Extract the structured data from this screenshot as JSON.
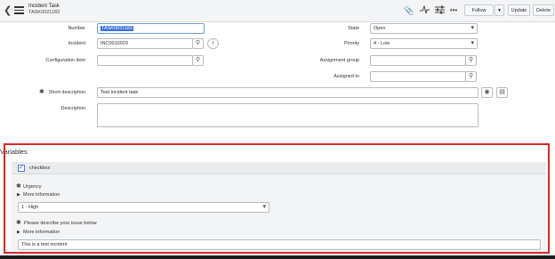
{
  "header": {
    "title": "Incident Task",
    "subtitle": "TASK0021183",
    "buttons": {
      "follow": "Follow",
      "update": "Update",
      "delete": "Delete"
    },
    "icons": [
      "paperclip-icon",
      "activity-icon",
      "settings-sliders-icon",
      "more-icon"
    ]
  },
  "form": {
    "number": {
      "label": "Number",
      "value": "TASK0021183"
    },
    "incident": {
      "label": "Incident",
      "value": "INC0010029"
    },
    "configuration_item": {
      "label": "Configuration item",
      "value": ""
    },
    "state": {
      "label": "State",
      "value": "Open"
    },
    "priority": {
      "label": "Priority",
      "value": "4 - Low"
    },
    "assignment_group": {
      "label": "Assignment group",
      "value": ""
    },
    "assigned_to": {
      "label": "Assigned to",
      "value": ""
    },
    "short_description": {
      "label": "Short description",
      "value": "Test incident task"
    },
    "description": {
      "label": "Description",
      "value": ""
    }
  },
  "variables": {
    "title": "Variables",
    "checkbox_label": "checkbox",
    "urgency": {
      "label": "Urgency",
      "more_info": "More information",
      "value": "1 - High"
    },
    "issue": {
      "label": "Please describe your issue below",
      "more_info": "More information",
      "value": "This is a test incident"
    }
  },
  "colors": {
    "highlight_outline": "#d92828",
    "selection": "#3b6fd8"
  }
}
